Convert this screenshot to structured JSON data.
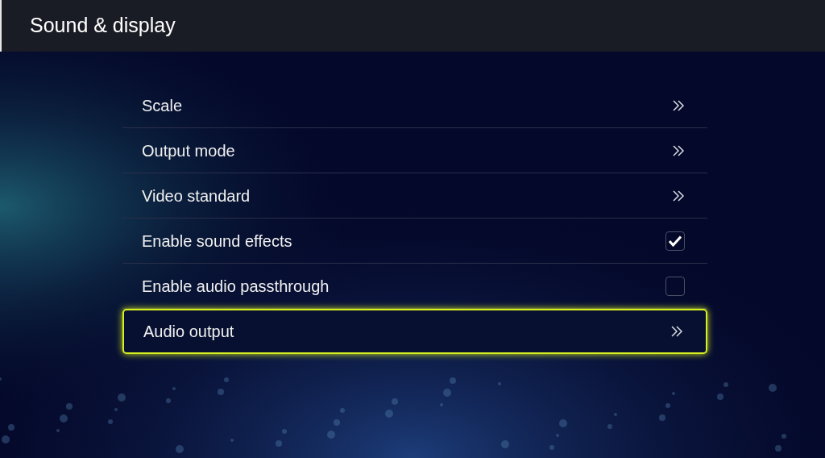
{
  "header": {
    "title": "Sound & display"
  },
  "items": [
    {
      "label": "Scale",
      "kind": "link",
      "selected": false
    },
    {
      "label": "Output mode",
      "kind": "link",
      "selected": false
    },
    {
      "label": "Video standard",
      "kind": "link",
      "selected": false
    },
    {
      "label": "Enable sound effects",
      "kind": "checkbox",
      "checked": true,
      "selected": false
    },
    {
      "label": "Enable audio passthrough",
      "kind": "checkbox",
      "checked": false,
      "selected": false
    },
    {
      "label": "Audio output",
      "kind": "link",
      "selected": true
    }
  ]
}
